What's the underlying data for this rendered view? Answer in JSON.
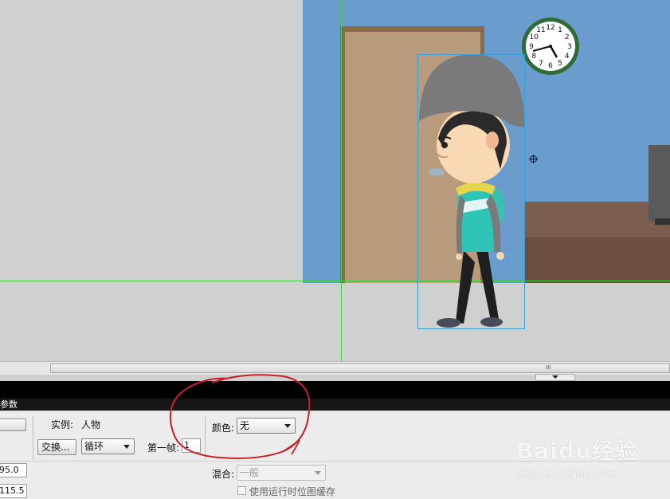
{
  "stage": {
    "clock_numbers": [
      "12",
      "1",
      "2",
      "3",
      "4",
      "5",
      "6",
      "7",
      "8",
      "9",
      "10",
      "11"
    ]
  },
  "scrollbar": {
    "grip": "III"
  },
  "panel": {
    "header_title": "参数",
    "instance_label": "实例:",
    "instance_value": "人物",
    "swap_button": "交换...",
    "loop_select": "循环",
    "first_frame_label": "第一帧:",
    "first_frame_value": "1",
    "color_label": "颜色:",
    "color_select": "无",
    "blend_label": "混合:",
    "blend_select": "一般",
    "cache_checkbox_label": "使用运行时位图缓存",
    "x_value": "95.0",
    "y_value": "115.5"
  },
  "watermark": {
    "brand": "Baidu经验",
    "url": "jingyan.baidu.com"
  },
  "colors": {
    "annotation": "#c8202a",
    "guide": "#3bd13b",
    "selection": "#3a9fd9",
    "room_wall": "#6a9ccd"
  }
}
